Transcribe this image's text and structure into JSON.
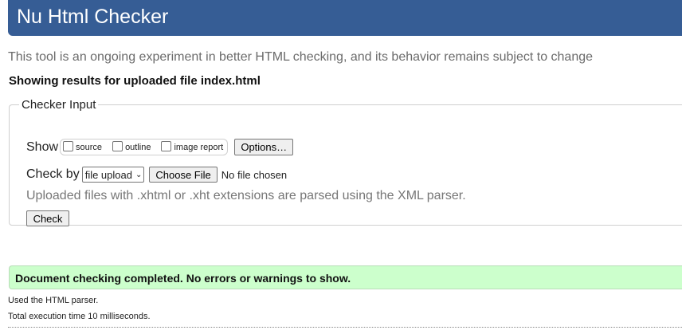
{
  "header": {
    "title": "Nu Html Checker"
  },
  "tagline": "This tool is an ongoing experiment in better HTML checking, and its behavior remains subject to change",
  "results_heading": "Showing results for uploaded file index.html",
  "checker_input": {
    "legend": "Checker Input",
    "show": {
      "label": "Show",
      "options": [
        {
          "label": "source",
          "checked": false
        },
        {
          "label": "outline",
          "checked": false
        },
        {
          "label": "image report",
          "checked": false
        }
      ],
      "options_button": "Options…"
    },
    "check_by": {
      "label": "Check by",
      "selected": "file upload",
      "choose_file_button": "Choose File",
      "no_file_text": "No file chosen"
    },
    "hint": "Uploaded files with .xhtml or .xht extensions are parsed using the XML parser.",
    "check_button": "Check"
  },
  "result": {
    "message": "Document checking completed. No errors or warnings to show.",
    "color": "#ccffcc"
  },
  "stats": {
    "parser": "Used the HTML parser.",
    "time": "Total execution time 10 milliseconds."
  },
  "colors": {
    "header_bg": "#365d95"
  }
}
